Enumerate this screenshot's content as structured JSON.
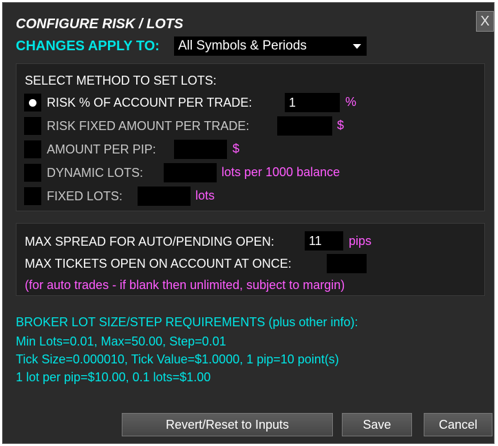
{
  "dialog": {
    "title": "CONFIGURE RISK / LOTS",
    "close_label": "X",
    "apply_label": "CHANGES APPLY TO:",
    "apply_value": "All Symbols & Periods"
  },
  "method": {
    "heading": "SELECT METHOD TO SET LOTS:",
    "options": [
      {
        "label": "RISK % OF ACCOUNT PER TRADE:",
        "value": "1",
        "unit": "%",
        "selected": true
      },
      {
        "label": "RISK FIXED AMOUNT PER TRADE:",
        "value": "",
        "unit": "$",
        "selected": false
      },
      {
        "label": "AMOUNT PER PIP:",
        "value": "",
        "unit": "$",
        "selected": false
      },
      {
        "label": "DYNAMIC LOTS:",
        "value": "",
        "unit": "lots per 1000 balance",
        "selected": false
      },
      {
        "label": "FIXED LOTS:",
        "value": "",
        "unit": "lots",
        "selected": false
      }
    ]
  },
  "limits": {
    "max_spread_label": "MAX SPREAD FOR AUTO/PENDING OPEN:",
    "max_spread_value": "11",
    "max_spread_unit": "pips",
    "max_tickets_label": "MAX TICKETS OPEN ON ACCOUNT AT ONCE:",
    "max_tickets_value": "",
    "note": "(for auto trades - if blank then unlimited, subject to margin)"
  },
  "broker": {
    "heading": "BROKER LOT SIZE/STEP REQUIREMENTS (plus other info):",
    "lines": [
      "Min Lots=0.01, Max=50.00, Step=0.01",
      "Tick Size=0.000010, Tick Value=$1.0000, 1 pip=10 point(s)",
      "1 lot per pip=$10.00, 0.1 lots=$1.00"
    ]
  },
  "buttons": {
    "revert": "Revert/Reset to Inputs",
    "save": "Save",
    "cancel": "Cancel"
  },
  "colors": {
    "background": "#2b2b2b",
    "panel": "#1f1f1f",
    "cyan": "#00e5e5",
    "magenta": "#ff5cff"
  }
}
